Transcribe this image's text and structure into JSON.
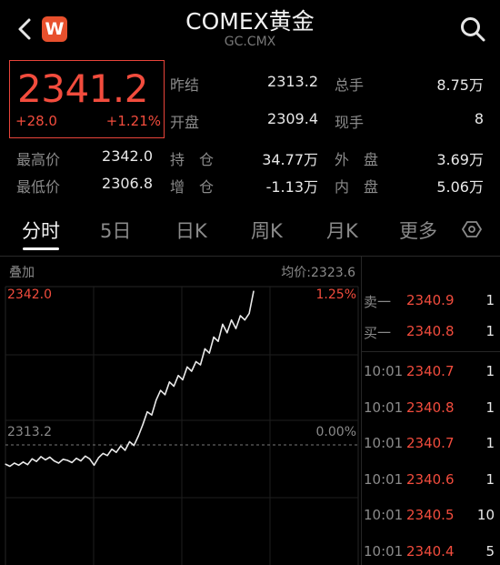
{
  "header": {
    "badge": "W",
    "title": "COMEX黄金",
    "subtitle": "GC.CMX"
  },
  "quote": {
    "price": "2341.2",
    "change": "+28.0",
    "change_pct": "+1.21%"
  },
  "stats": {
    "prev_close_label": "昨结",
    "prev_close": "2313.2",
    "total_vol_label": "总手",
    "total_vol": "8.75万",
    "open_label": "开盘",
    "open": "2309.4",
    "cur_vol_label": "现手",
    "cur_vol": "8",
    "high_label": "最高价",
    "high": "2342.0",
    "hold_label": "持　仓",
    "hold": "34.77万",
    "outer_label": "外　盘",
    "outer": "3.69万",
    "low_label": "最低价",
    "low": "2306.8",
    "inc_label": "增　仓",
    "inc": "-1.13万",
    "inner_label": "内　盘",
    "inner": "5.06万"
  },
  "tabs": [
    "分时",
    "5日",
    "日K",
    "周K",
    "月K",
    "更多"
  ],
  "chart": {
    "overlay_label": "叠加",
    "avg_label": "均价:2323.6",
    "top_price": "2342.0",
    "top_pct": "1.25%",
    "base_price": "2313.2",
    "base_pct": "0.00%"
  },
  "orderbook": {
    "sell1_label": "卖一",
    "sell1_price": "2340.9",
    "sell1_vol": "1",
    "buy1_label": "买一",
    "buy1_price": "2340.8",
    "buy1_vol": "1"
  },
  "trades": [
    {
      "time": "10:01",
      "price": "2340.7",
      "vol": "1"
    },
    {
      "time": "10:01",
      "price": "2340.8",
      "vol": "1"
    },
    {
      "time": "10:01",
      "price": "2340.7",
      "vol": "1"
    },
    {
      "time": "10:01",
      "price": "2340.6",
      "vol": "1"
    },
    {
      "time": "10:01",
      "price": "2340.5",
      "vol": "10"
    },
    {
      "time": "10:01",
      "price": "2340.4",
      "vol": "5"
    }
  ],
  "chart_data": {
    "type": "line",
    "y_range": [
      2313.2,
      2342.0
    ],
    "reference_line": 2313.2,
    "series": [
      {
        "values": [
          2309.6,
          2309.2,
          2309.8,
          2309.4,
          2310.0,
          2309.5,
          2310.6,
          2310.1,
          2311.0,
          2310.4,
          2310.9,
          2310.2,
          2309.8,
          2310.5,
          2310.3,
          2309.9,
          2310.7,
          2310.2,
          2311.1,
          2310.6,
          2309.4,
          2310.8,
          2311.6,
          2311.2,
          2312.4,
          2311.8,
          2313.0,
          2312.2,
          2313.8,
          2313.1,
          2314.9,
          2317.0,
          2319.4,
          2318.8,
          2321.6,
          2323.4,
          2322.6,
          2325.0,
          2324.2,
          2326.2,
          2325.4,
          2327.8,
          2327.0,
          2328.8,
          2328.2,
          2331.2,
          2330.4,
          2333.4,
          2332.6,
          2335.8,
          2334.2,
          2336.6,
          2335.0,
          2337.4,
          2336.6,
          2337.8,
          2342.0
        ]
      }
    ]
  }
}
